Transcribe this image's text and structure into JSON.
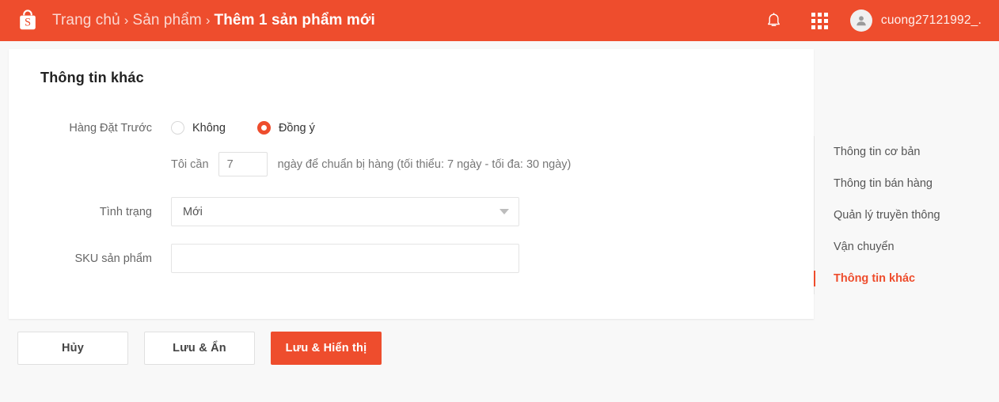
{
  "header": {
    "logo_icon": "shopee-bag-icon",
    "breadcrumb": {
      "home": "Trang chủ",
      "products": "Sản phẩm",
      "current": "Thêm 1 sản phẩm mới",
      "separator": "›"
    },
    "bell_icon": "notification-bell-icon",
    "apps_icon": "apps-grid-icon",
    "avatar_icon": "user-avatar-icon",
    "username": "cuong27121992_.",
    "brand_color": "#ee4d2d"
  },
  "card": {
    "title": "Thông tin khác",
    "preorder": {
      "label": "Hàng Đặt Trước",
      "option_no": "Không",
      "option_yes": "Đồng ý",
      "selected": "Đồng ý"
    },
    "days": {
      "prefix": "Tôi cần",
      "value": "7",
      "suffix": "ngày để chuẩn bị hàng (tối thiểu: 7 ngày - tối đa: 30 ngày)"
    },
    "condition": {
      "label": "Tình trạng",
      "value": "Mới",
      "caret_icon": "chevron-down-icon"
    },
    "sku": {
      "label": "SKU sản phẩm",
      "value": "",
      "placeholder": ""
    }
  },
  "sidenav": {
    "items": [
      {
        "label": "Thông tin cơ bản",
        "active": false
      },
      {
        "label": "Thông tin bán hàng",
        "active": false
      },
      {
        "label": "Quản lý truyền thông",
        "active": false
      },
      {
        "label": "Vận chuyển",
        "active": false
      },
      {
        "label": "Thông tin khác",
        "active": true
      }
    ],
    "active_color": "#ee4d2d"
  },
  "footer": {
    "cancel": "Hủy",
    "save_hide": "Lưu & Ẩn",
    "save_show": "Lưu & Hiển thị"
  }
}
